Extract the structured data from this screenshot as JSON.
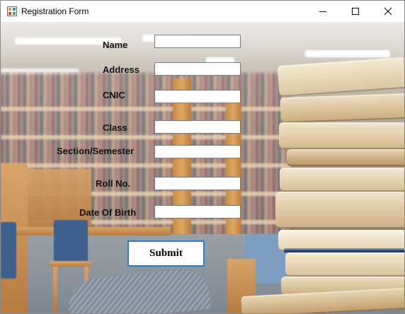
{
  "window": {
    "title": "Registration Form",
    "icon": "form-app-icon"
  },
  "controls": {
    "minimize_icon": "minimize-icon",
    "maximize_icon": "maximize-icon",
    "close_icon": "close-icon"
  },
  "form": {
    "fields": [
      {
        "label": "Name",
        "value": ""
      },
      {
        "label": "Address",
        "value": ""
      },
      {
        "label": "CNIC",
        "value": ""
      },
      {
        "label": "Class",
        "value": ""
      },
      {
        "label": "Section/Semester",
        "value": ""
      },
      {
        "label": "Roll No.",
        "value": ""
      },
      {
        "label": "Date Of Birth",
        "value": ""
      }
    ],
    "submit_label": "Submit"
  },
  "colors": {
    "submit_border": "#2a7fc9",
    "label_text": "#111111"
  }
}
